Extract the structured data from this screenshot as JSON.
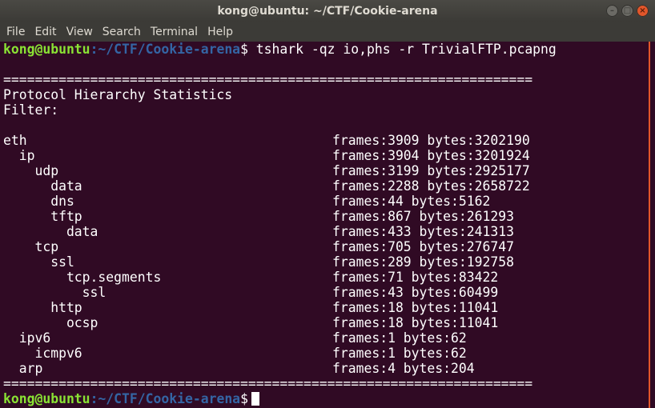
{
  "window": {
    "title": "kong@ubuntu: ~/CTF/Cookie-arena",
    "controls": {
      "minimize": "–",
      "maximize": "□",
      "close": "×"
    }
  },
  "menu": [
    "File",
    "Edit",
    "View",
    "Search",
    "Terminal",
    "Help"
  ],
  "prompt": {
    "user": "kong@ubuntu",
    "path": ":~/CTF/Cookie-arena",
    "symbol": "$",
    "command": " tshark -qz io,phs -r TrivialFTP.pcapng"
  },
  "output": {
    "separator": "===================================================================",
    "heading": "Protocol Hierarchy Statistics",
    "filter": "Filter:",
    "rows": [
      {
        "protocol": "eth",
        "stats": "frames:3909 bytes:3202190"
      },
      {
        "protocol": "  ip",
        "stats": "frames:3904 bytes:3201924"
      },
      {
        "protocol": "    udp",
        "stats": "frames:3199 bytes:2925177"
      },
      {
        "protocol": "      data",
        "stats": "frames:2288 bytes:2658722"
      },
      {
        "protocol": "      dns",
        "stats": "frames:44 bytes:5162"
      },
      {
        "protocol": "      tftp",
        "stats": "frames:867 bytes:261293"
      },
      {
        "protocol": "        data",
        "stats": "frames:433 bytes:241313"
      },
      {
        "protocol": "    tcp",
        "stats": "frames:705 bytes:276747"
      },
      {
        "protocol": "      ssl",
        "stats": "frames:289 bytes:192758"
      },
      {
        "protocol": "        tcp.segments",
        "stats": "frames:71 bytes:83422"
      },
      {
        "protocol": "          ssl",
        "stats": "frames:43 bytes:60499"
      },
      {
        "protocol": "      http",
        "stats": "frames:18 bytes:11041"
      },
      {
        "protocol": "        ocsp",
        "stats": "frames:18 bytes:11041"
      },
      {
        "protocol": "  ipv6",
        "stats": "frames:1 bytes:62"
      },
      {
        "protocol": "    icmpv6",
        "stats": "frames:1 bytes:62"
      },
      {
        "protocol": "  arp",
        "stats": "frames:4 bytes:204"
      }
    ]
  }
}
